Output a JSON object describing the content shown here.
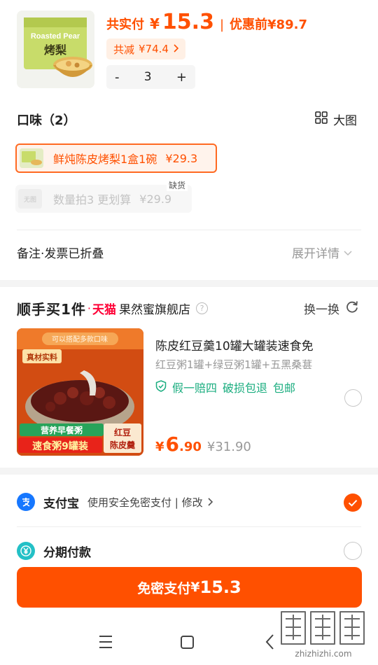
{
  "order": {
    "paid_label": "共实付",
    "currency": "¥",
    "paid_amount": "15.3",
    "separator": "|",
    "original_label": "优惠前",
    "original_amount": "¥89.7",
    "saved_label": "共减",
    "saved_amount": "¥74.4",
    "qty_minus": "-",
    "qty_value": "3",
    "qty_plus": "+"
  },
  "product_image_text": {
    "line1": "Roasted Pear",
    "line2": "烤梨"
  },
  "flavor": {
    "title": "口味（2）",
    "big_view_label": "大图",
    "options": [
      {
        "label": "鲜炖陈皮烤梨1盒1碗",
        "price": "¥29.3",
        "state": "selected"
      },
      {
        "label": "数量拍3 更划算",
        "price": "¥29.9",
        "state": "disabled",
        "no_image": "无图",
        "tag": "缺货"
      }
    ]
  },
  "notes": {
    "label": "备注·发票已折叠",
    "expand_label": "展开详情"
  },
  "addon": {
    "heading": "顺手买1件",
    "dot": "·",
    "platform": "天猫",
    "store": "果然蜜旗舰店",
    "info_icon": "?",
    "swap_label": "换一换",
    "product": {
      "title": "陈皮红豆羹10罐大罐装速食免",
      "subtitle": "红豆粥1罐+绿豆粥1罐+五黑桑葚",
      "guarantee": [
        "假一赔四",
        "破损包退",
        "包邮"
      ],
      "price_currency": "¥",
      "price_int": "6",
      "price_dec": ".90",
      "original_price": "¥31.90",
      "image_texts": {
        "top_banner": "可以搭配多款口味",
        "tag": "真材实料",
        "green_label": "营养早餐粥",
        "red_label": "速食粥9罐装",
        "side_line1": "红豆",
        "side_line2": "陈皮羹"
      }
    }
  },
  "payment": {
    "methods": [
      {
        "name": "支付宝",
        "desc": "使用安全免密支付 | 修改",
        "selected": true
      },
      {
        "name": "分期付款",
        "desc": "",
        "selected": false
      }
    ],
    "button_label": "免密支付",
    "button_currency": "¥",
    "button_amount": "15.3"
  },
  "watermark": {
    "text": "zhizhizhi.com"
  },
  "colors": {
    "accent": "#ff5000",
    "tmall_red": "#ff0036",
    "guarantee_green": "#1aad7f",
    "alipay_blue": "#1677ff",
    "installment_teal": "#23c0c6"
  }
}
